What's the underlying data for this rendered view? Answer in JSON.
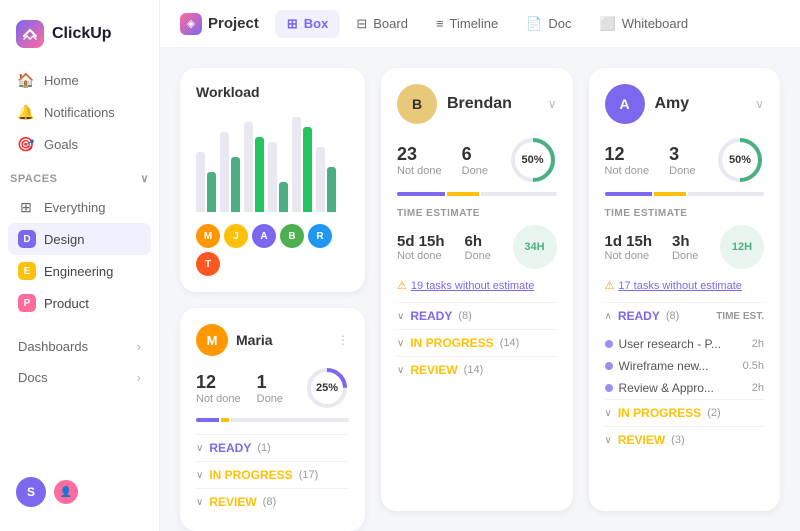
{
  "app": {
    "name": "ClickUp",
    "logo_letter": "C"
  },
  "sidebar": {
    "nav_items": [
      {
        "id": "home",
        "label": "Home",
        "icon": "🏠"
      },
      {
        "id": "notifications",
        "label": "Notifications",
        "icon": "🔔"
      },
      {
        "id": "goals",
        "label": "Goals",
        "icon": "🎯"
      }
    ],
    "spaces_label": "Spaces",
    "spaces": [
      {
        "id": "everything",
        "label": "Everything",
        "icon": "⊞"
      },
      {
        "id": "design",
        "label": "Design",
        "letter": "D",
        "color_class": "dot-d",
        "active": true
      },
      {
        "id": "engineering",
        "label": "Engineering",
        "letter": "E",
        "color_class": "dot-e"
      },
      {
        "id": "product",
        "label": "Product",
        "letter": "P",
        "color_class": "dot-p"
      }
    ],
    "bottom_nav": [
      {
        "id": "dashboards",
        "label": "Dashboards"
      },
      {
        "id": "docs",
        "label": "Docs"
      }
    ]
  },
  "topnav": {
    "project_label": "Project",
    "tabs": [
      {
        "id": "box",
        "label": "Box",
        "active": true
      },
      {
        "id": "board",
        "label": "Board"
      },
      {
        "id": "timeline",
        "label": "Timeline"
      },
      {
        "id": "doc",
        "label": "Doc"
      },
      {
        "id": "whiteboard",
        "label": "Whiteboard"
      }
    ]
  },
  "workload": {
    "title": "Workload",
    "bars": [
      {
        "gray": 60,
        "green": 40
      },
      {
        "gray": 80,
        "green": 55
      },
      {
        "gray": 90,
        "green": 75
      },
      {
        "gray": 70,
        "green": 30
      },
      {
        "gray": 95,
        "green": 85
      },
      {
        "gray": 65,
        "green": 45
      }
    ],
    "avatar_colors": [
      "#ff6b9d",
      "#ffc107",
      "#7b68ee",
      "#4caf50",
      "#2196f3",
      "#ff5722"
    ]
  },
  "brendan": {
    "name": "Brendan",
    "not_done": 23,
    "not_done_label": "Not done",
    "done": 6,
    "done_label": "Done",
    "progress_pct": 50,
    "progress_label": "50%",
    "time_estimate_label": "TIME ESTIMATE",
    "time_not_done": "5d 15h",
    "time_not_done_label": "Not done",
    "time_done": "6h",
    "time_done_label": "Done",
    "time_total": "34H",
    "warning_text": "19 tasks without estimate",
    "sections": [
      {
        "id": "ready",
        "label": "READY",
        "count": "(8)",
        "color": "ready"
      },
      {
        "id": "inprogress",
        "label": "IN PROGRESS",
        "count": "(14)",
        "color": "inprogress"
      },
      {
        "id": "review",
        "label": "REVIEW",
        "count": "(14)",
        "color": "review"
      }
    ],
    "avatar_bg": "#e8c97a"
  },
  "amy": {
    "name": "Amy",
    "not_done": 12,
    "not_done_label": "Not done",
    "done": 3,
    "done_label": "Done",
    "progress_pct": 50,
    "progress_label": "50%",
    "time_estimate_label": "TIME ESTIMATE",
    "time_not_done": "1d 15h",
    "time_not_done_label": "Not done",
    "time_done": "3h",
    "time_done_label": "Done",
    "time_total": "12H",
    "warning_text": "17 tasks without estimate",
    "ready_label": "READY",
    "ready_count": "(8)",
    "ready_time_label": "TIME EST.",
    "tasks": [
      {
        "name": "User research - P...",
        "time": "2h"
      },
      {
        "name": "Wireframe new...",
        "time": "0.5h"
      },
      {
        "name": "Review & Appro...",
        "time": "2h"
      }
    ],
    "inprogress_label": "IN PROGRESS",
    "inprogress_count": "(2)",
    "review_label": "REVIEW",
    "review_count": "(3)",
    "avatar_bg": "#7b68ee"
  },
  "maria": {
    "name": "Maria",
    "not_done": 12,
    "not_done_label": "Not done",
    "done": 1,
    "done_label": "Done",
    "progress_pct": 25,
    "progress_label": "25%",
    "sections": [
      {
        "id": "ready",
        "label": "READY",
        "count": "(1)",
        "color": "ready"
      },
      {
        "id": "inprogress",
        "label": "IN PROGRESS",
        "count": "(17)",
        "color": "inprogress"
      },
      {
        "id": "review",
        "label": "REVIEW",
        "count": "(8)",
        "color": "review"
      }
    ],
    "avatar_bg": "#ff9800"
  }
}
